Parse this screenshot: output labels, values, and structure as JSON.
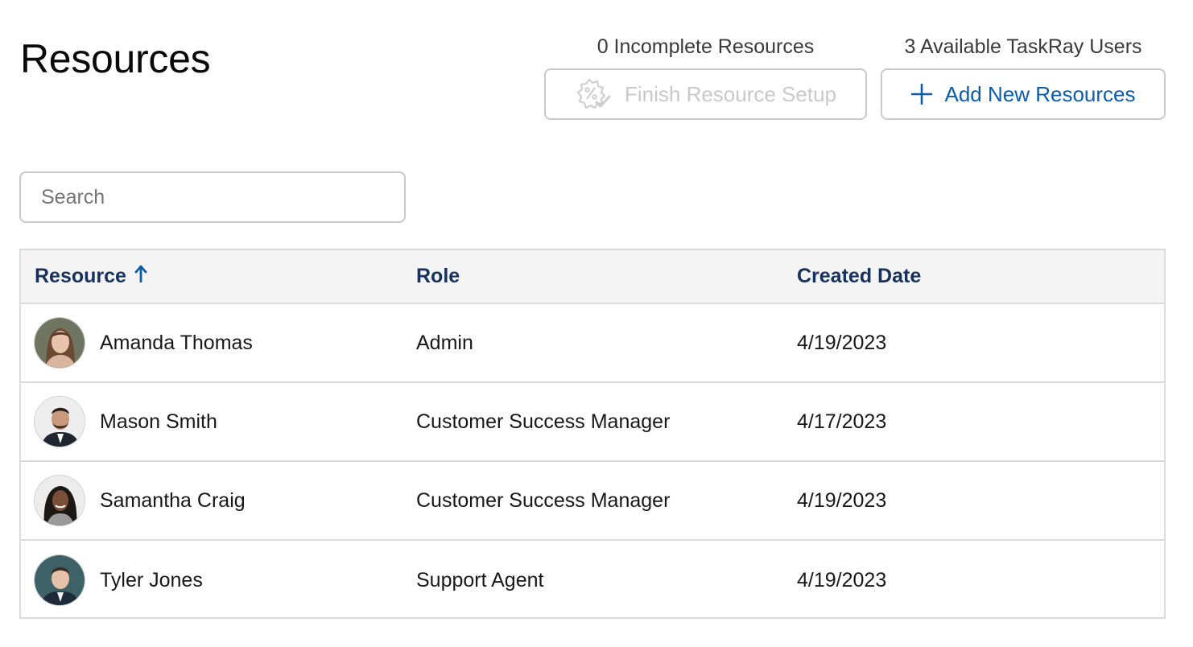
{
  "page": {
    "title": "Resources"
  },
  "actions": {
    "incomplete_count_label": "0 Incomplete Resources",
    "finish_setup_label": "Finish Resource Setup",
    "available_users_label": "3 Available TaskRay Users",
    "add_resources_label": "Add New Resources"
  },
  "search": {
    "placeholder": "Search",
    "value": ""
  },
  "table": {
    "columns": [
      {
        "label": "Resource",
        "sorted": "ascending"
      },
      {
        "label": "Role"
      },
      {
        "label": "Created Date"
      }
    ],
    "rows": [
      {
        "name": "Amanda Thomas",
        "role": "Admin",
        "created": "4/19/2023"
      },
      {
        "name": "Mason Smith",
        "role": "Customer Success Manager",
        "created": "4/17/2023"
      },
      {
        "name": "Samantha Craig",
        "role": "Customer Success Manager",
        "created": "4/19/2023"
      },
      {
        "name": "Tyler Jones",
        "role": "Support Agent",
        "created": "4/19/2023"
      }
    ]
  },
  "colors": {
    "accent": "#0b5cab",
    "header_text": "#16325c",
    "border": "#dddbda",
    "disabled": "#c9c9c9"
  }
}
